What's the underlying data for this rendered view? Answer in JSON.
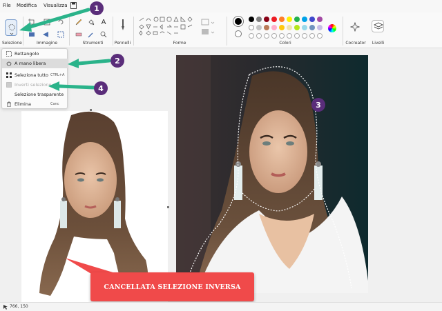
{
  "menu": {
    "file": "File",
    "edit": "Modifica",
    "view": "Visualizza"
  },
  "ribbon": {
    "groups": {
      "selection": "Selezione",
      "image": "Immagine",
      "tools": "Strumenti",
      "brushes": "Pennelli",
      "shapes": "Forme",
      "colors": "Colori",
      "cocreator": "Cocreator",
      "layers": "Livelli"
    }
  },
  "palette": [
    "#000000",
    "#7f7f7f",
    "#880015",
    "#ed1c24",
    "#ff7f27",
    "#fff200",
    "#22b14c",
    "#00a2e8",
    "#3f48cc",
    "#a349a4",
    "#ffffff",
    "#c3c3c3",
    "#b97a57",
    "#ffaec9",
    "#ffc90e",
    "#efe4b0",
    "#b5e61d",
    "#99d9ea",
    "#7092be",
    "#c8bfe7"
  ],
  "dropdown": {
    "items": [
      {
        "label": "Rettangolo",
        "shortcut": ""
      },
      {
        "label": "A mano libera",
        "shortcut": ""
      },
      {
        "label": "Seleziona tutto",
        "shortcut": "CTRL+A"
      },
      {
        "label": "Inverti selezione",
        "shortcut": ""
      },
      {
        "label": "Selezione trasparente",
        "shortcut": ""
      },
      {
        "label": "Elimina",
        "shortcut": "Canc"
      }
    ]
  },
  "badges": [
    "1",
    "2",
    "3",
    "4"
  ],
  "banner": {
    "text": "CANCELLATA SELEZIONE INVERSA"
  },
  "status": {
    "coords": "766, 150"
  },
  "colors": {
    "arrow": "#2ab38a",
    "badge": "#5a2d7a",
    "banner": "#f04a4a"
  }
}
